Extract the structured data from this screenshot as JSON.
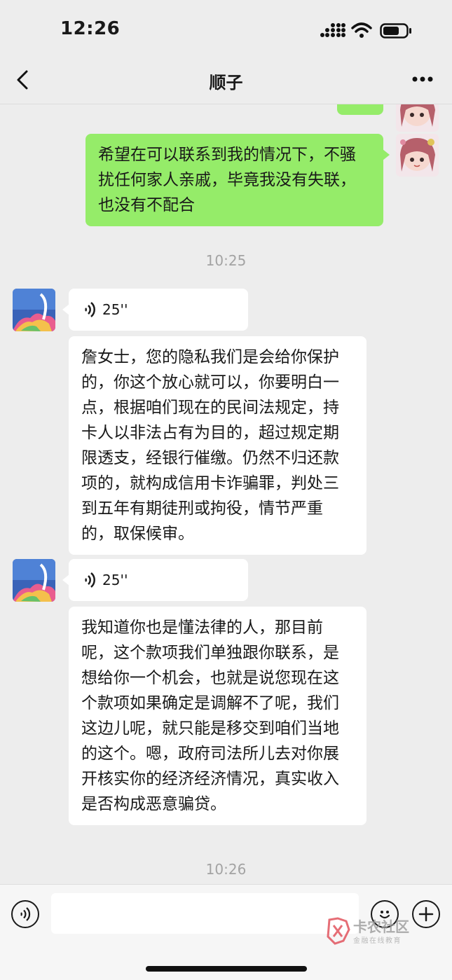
{
  "status_bar": {
    "time": "12:26"
  },
  "header": {
    "title": "顺子"
  },
  "messages": [
    {
      "sender": "me",
      "type": "text",
      "text": "希望在可以联系到我的情况下，不骚扰任何家人亲戚，毕竟我没有失联，也没有不配合"
    },
    {
      "type": "timestamp",
      "text": "10:25"
    },
    {
      "sender": "other",
      "type": "voice",
      "duration": "25''"
    },
    {
      "sender": "other",
      "type": "text",
      "text": "詹女士，您的隐私我们是会给你保护的，你这个放心就可以，你要明白一点，根据咱们现在的民间法规定，持卡人以非法占有为目的，超过规定期限透支，经银行催缴。仍然不归还款项的，就构成信用卡诈骗罪，判处三到五年有期徒刑或拘役，情节严重的，取保候审。"
    },
    {
      "sender": "other",
      "type": "voice",
      "duration": "25''"
    },
    {
      "sender": "other",
      "type": "text",
      "text": "我知道你也是懂法律的人，那目前呢，这个款项我们单独跟你联系，是想给你一个机会，也就是说您现在这个款项如果确定是调解不了呢，我们这边儿呢，就只能是移交到咱们当地的这个。嗯，政府司法所儿去对你展开核实你的经济经济情况，真实收入是否构成恶意骗贷。"
    },
    {
      "type": "timestamp",
      "text": "10:26"
    }
  ],
  "input_bar": {
    "voice_icon": "voice-mode-icon",
    "emoji_icon": "emoji-icon",
    "plus_icon": "plus-icon"
  },
  "watermark": {
    "title": "卡农社区",
    "subtitle": "金融在线教育"
  },
  "colors": {
    "my_bubble": "#95ec69",
    "their_bubble": "#ffffff",
    "background": "#ededed"
  }
}
